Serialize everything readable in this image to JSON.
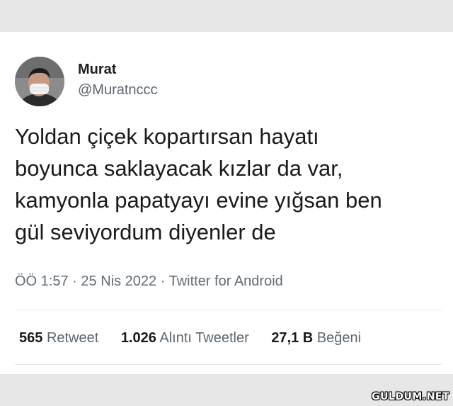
{
  "tweet": {
    "author_name": "Murat",
    "author_handle": "@Muratnccc",
    "text_lines": [
      "Yoldan çiçek kopartırsan hayatı",
      "boyunca saklayacak kızlar da var,",
      "kamyonla papatyayı evine yığsan ben",
      "gül seviyordum diyenler de"
    ],
    "time": "ÖÖ 1:57",
    "date": "25 Nis 2022",
    "source": "Twitter for Android",
    "separator": "·"
  },
  "stats": {
    "retweets": {
      "count": "565",
      "label": "Retweet"
    },
    "quotes": {
      "count": "1.026",
      "label": "Alıntı Tweetler"
    },
    "likes": {
      "count": "27,1 B",
      "label": "Beğeni"
    }
  },
  "watermark": "GULDUM.NET",
  "colors": {
    "background": "#e7e7e7",
    "card": "#ffffff",
    "text_primary": "#1a1a1a",
    "text_secondary": "#5b6670"
  }
}
